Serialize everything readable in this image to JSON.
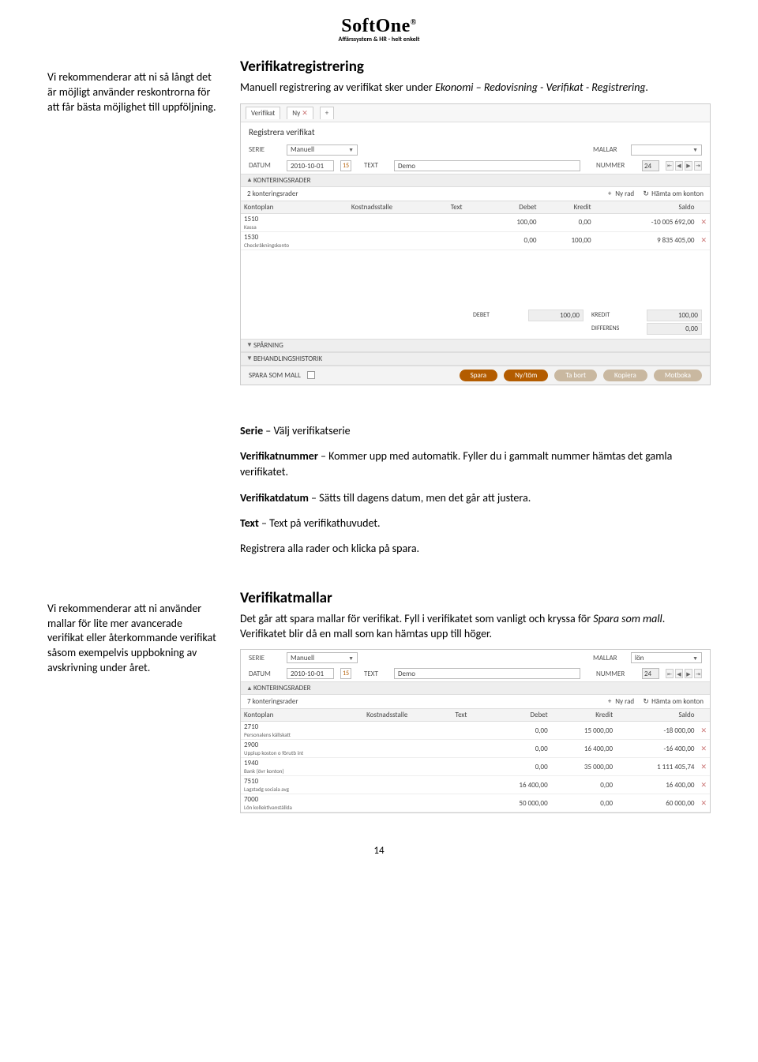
{
  "logo": {
    "main": "SoftOne",
    "reg": "®",
    "sub": "Affärssystem & HR - helt enkelt"
  },
  "section1": {
    "sideNote": "Vi rekommenderar att ni så långt det är möjligt använder reskontrorna för att får bästa möjlighet till uppföljning.",
    "heading": "Verifikatregistrering",
    "intro_pre": "Manuell registrering av verifikat sker under ",
    "intro_path": "Ekonomi – Redovisning - Verifikat - Registrering."
  },
  "shot1": {
    "tabs": {
      "t1": "Verifikat",
      "t2": "Ny",
      "close": "✕",
      "plus": "+"
    },
    "panelTitle": "Registrera verifikat",
    "labels": {
      "serie": "SERIE",
      "serieVal": "Manuell",
      "mallar": "MALLAR",
      "datum": "DATUM",
      "datumVal": "2010-10-01",
      "text": "TEXT",
      "textVal": "Demo",
      "nummer": "NUMMER",
      "nummerVal": "24"
    },
    "sections": {
      "konteringsrader": "KONTERINGSRADER",
      "rowsCount": "2 konteringsrader",
      "nyRad": "Ny rad",
      "hamta": "Hämta om konton",
      "sparning": "SPÅRNING",
      "historik": "BEHANDLINGSHISTORIK"
    },
    "gridHeaders": {
      "kontoplan": "Kontoplan",
      "kostnad": "Kostnadsstalle",
      "text": "Text",
      "debet": "Debet",
      "kredit": "Kredit",
      "saldo": "Saldo"
    },
    "rows": [
      {
        "kp": "1510",
        "sub": "Kassa",
        "debet": "100,00",
        "kredit": "0,00",
        "saldo": "-10 005 692,00"
      },
      {
        "kp": "1530",
        "sub": "Checkräkningskonto",
        "debet": "0,00",
        "kredit": "100,00",
        "saldo": "9 835 405,00"
      }
    ],
    "totals": {
      "debetLabel": "DEBET",
      "debetVal": "100,00",
      "kreditLabel": "KREDIT",
      "kreditVal": "100,00",
      "diffLabel": "DIFFERENS",
      "diffVal": "0,00"
    },
    "buttons": {
      "sparaSomMall": "SPARA SOM MALL",
      "spara": "Spara",
      "nytom": "Ny/töm",
      "tabort": "Ta bort",
      "kopiera": "Kopiera",
      "motboka": "Motboka"
    }
  },
  "desc": {
    "p1_b": "Serie",
    "p1": " – Välj verifikatserie",
    "p2_b": "Verifikatnummer",
    "p2": " – Kommer upp med automatik. Fyller du i gammalt nummer hämtas det gamla verifikatet.",
    "p3_b": "Verifikatdatum",
    "p3": " – Sätts till dagens datum, men det går att justera.",
    "p4_b": "Text",
    "p4": " – Text på verifikathuvudet.",
    "p5": "Registrera alla rader och klicka på spara."
  },
  "section2": {
    "sideNote": "Vi rekommenderar att ni använder mallar för lite mer avancerade verifikat eller återkommande verifikat såsom exempelvis uppbokning av avskrivning under året.",
    "heading": "Verifikatmallar",
    "intro_pre": "Det går att spara mallar för verifikat. Fyll i verifikatet som vanligt och kryssa för ",
    "intro_i": "Spara som mall",
    "intro_post": ". Verifikatet blir då en mall som kan hämtas upp till höger."
  },
  "shot2": {
    "labels": {
      "serie": "SERIE",
      "serieVal": "Manuell",
      "mallar": "MALLAR",
      "mallarVal": "lön",
      "datum": "DATUM",
      "datumVal": "2010-10-01",
      "text": "TEXT",
      "textVal": "Demo",
      "nummer": "NUMMER",
      "nummerVal": "24"
    },
    "sections": {
      "konteringsrader": "KONTERINGSRADER",
      "rowsCount": "7 konteringsrader",
      "nyRad": "Ny rad",
      "hamta": "Hämta om konton"
    },
    "gridHeaders": {
      "kontoplan": "Kontoplan",
      "kostnad": "Kostnadsstalle",
      "text": "Text",
      "debet": "Debet",
      "kredit": "Kredit",
      "saldo": "Saldo"
    },
    "rows": [
      {
        "kp": "2710",
        "sub": "Personalens källskatt",
        "debet": "0,00",
        "kredit": "15 000,00",
        "saldo": "-18 000,00"
      },
      {
        "kp": "2900",
        "sub": "Upplup koston o förutb int",
        "debet": "0,00",
        "kredit": "16 400,00",
        "saldo": "-16 400,00"
      },
      {
        "kp": "1940",
        "sub": "Bank (övr konton)",
        "debet": "0,00",
        "kredit": "35 000,00",
        "saldo": "1 111 405,74"
      },
      {
        "kp": "7510",
        "sub": "Lagstadg sociala avg",
        "debet": "16 400,00",
        "kredit": "0,00",
        "saldo": "16 400,00"
      },
      {
        "kp": "7000",
        "sub": "Lön kollektivanställda",
        "debet": "50 000,00",
        "kredit": "0,00",
        "saldo": "60 000,00"
      }
    ]
  },
  "pageNum": "14"
}
